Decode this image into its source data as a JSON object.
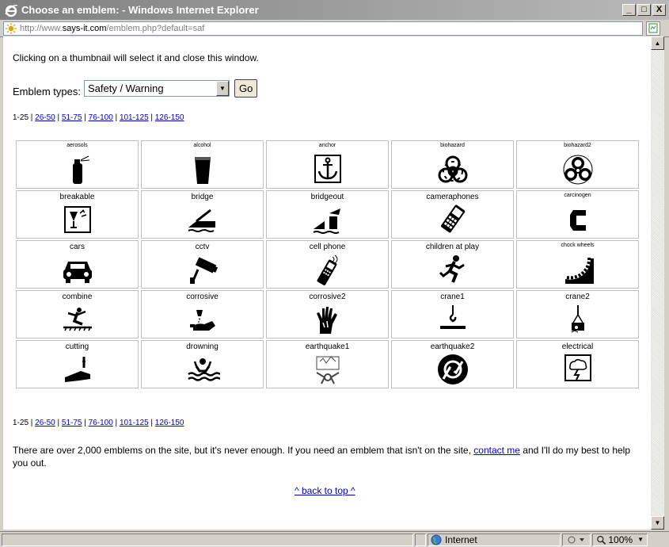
{
  "window": {
    "title": "Choose an emblem: - Windows Internet Explorer",
    "min": "_",
    "max": "□",
    "close": "X"
  },
  "address": {
    "prefix": "http://www.",
    "host": "says-it.com",
    "suffix": "/emblem.php?default=saf"
  },
  "page": {
    "intro": "Clicking on a thumbnail will select it and close this window.",
    "types_label": "Emblem types:",
    "select_value": "Safety / Warning",
    "go_label": "Go",
    "pager_current": "1-25",
    "pager_sep": " | ",
    "pager_links": [
      "26-50",
      "51-75",
      "76-100",
      "101-125",
      "126-150"
    ],
    "footer_before": "There are over 2,000 emblems on the site, but it's never enough. If you need an emblem that isn't on the site, ",
    "footer_link": "contact me",
    "footer_after": " and I'll do my best to help you out.",
    "back_to_top": "^ back to top ^"
  },
  "emblems": [
    [
      {
        "name": "aerosols",
        "small": true,
        "icon": "aerosol-icon"
      },
      {
        "name": "alcohol",
        "small": true,
        "icon": "glass-icon"
      },
      {
        "name": "anchor",
        "small": true,
        "icon": "anchor-icon"
      },
      {
        "name": "biohazard",
        "small": true,
        "icon": "biohazard-icon"
      },
      {
        "name": "biohazard2",
        "small": true,
        "icon": "biohazard-circle-icon"
      }
    ],
    [
      {
        "name": "breakable",
        "small": false,
        "icon": "broken-glass-icon"
      },
      {
        "name": "bridge",
        "small": false,
        "icon": "bridge-icon"
      },
      {
        "name": "bridgeout",
        "small": false,
        "icon": "bridge-out-icon"
      },
      {
        "name": "cameraphones",
        "small": false,
        "icon": "cameraphone-icon"
      },
      {
        "name": "carcinogen",
        "small": true,
        "icon": "carcinogen-icon"
      }
    ],
    [
      {
        "name": "cars",
        "small": false,
        "icon": "car-icon"
      },
      {
        "name": "cctv",
        "small": false,
        "icon": "cctv-icon"
      },
      {
        "name": "cell phone",
        "small": false,
        "icon": "cell-phone-icon"
      },
      {
        "name": "children at play",
        "small": false,
        "icon": "running-child-icon"
      },
      {
        "name": "chock wheels",
        "small": true,
        "icon": "wheel-chock-icon"
      }
    ],
    [
      {
        "name": "combine",
        "small": false,
        "icon": "combine-icon"
      },
      {
        "name": "corrosive",
        "small": false,
        "icon": "corrosive-icon"
      },
      {
        "name": "corrosive2",
        "small": false,
        "icon": "corrosive-hand-icon"
      },
      {
        "name": "crane1",
        "small": false,
        "icon": "crane-hook-icon"
      },
      {
        "name": "crane2",
        "small": false,
        "icon": "crane-load-icon"
      }
    ],
    [
      {
        "name": "cutting",
        "small": false,
        "icon": "cutting-hand-icon"
      },
      {
        "name": "drowning",
        "small": false,
        "icon": "drowning-icon"
      },
      {
        "name": "earthquake1",
        "small": false,
        "icon": "earthquake-icon"
      },
      {
        "name": "earthquake2",
        "small": false,
        "icon": "earthquake-disc-icon"
      },
      {
        "name": "electrical",
        "small": false,
        "icon": "lightning-cloud-icon"
      }
    ]
  ],
  "status": {
    "zone": "Internet",
    "zoom": "100%"
  }
}
